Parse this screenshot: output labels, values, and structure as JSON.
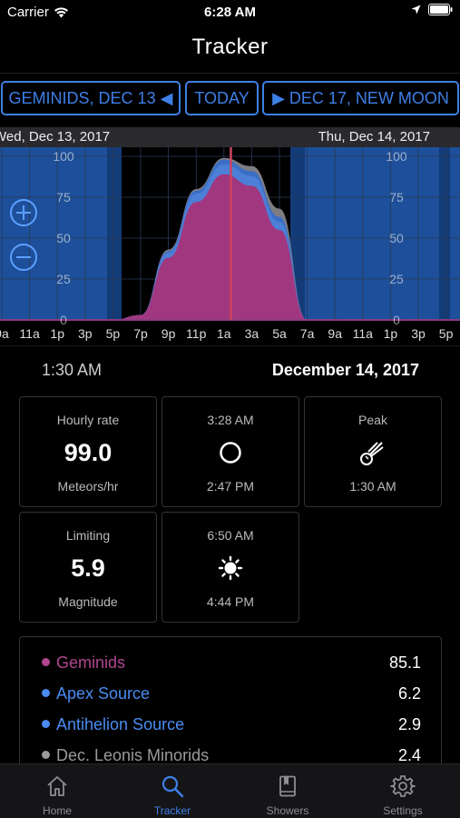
{
  "status_bar": {
    "carrier": "Carrier",
    "time": "6:28 AM"
  },
  "nav": {
    "title": "Tracker"
  },
  "date_nav": {
    "prev_label": "GEMINIDS, DEC 13 ◀",
    "today_label": "TODAY",
    "next_label": "▶ DEC 17, NEW MOON"
  },
  "date_strip": {
    "left": "Wed, Dec 13, 2017",
    "right": "Thu, Dec 14, 2017"
  },
  "chart_data": {
    "type": "area",
    "x": [
      "9a",
      "11a",
      "1p",
      "3p",
      "5p",
      "7p",
      "9p",
      "11p",
      "1a",
      "3a",
      "5a",
      "7a",
      "9a",
      "11a",
      "1p",
      "3p",
      "5p"
    ],
    "ytick_labels": [
      "100",
      "75",
      "50",
      "25",
      "0"
    ],
    "ylim": [
      0,
      100
    ],
    "selected_x": "1:30 AM",
    "series": [
      {
        "name": "Geminids",
        "color": "#a0377f",
        "values": [
          0,
          0,
          0,
          0,
          0,
          3,
          38,
          72,
          89,
          82,
          55,
          0,
          0,
          0,
          0,
          0,
          0
        ]
      },
      {
        "name": "Apex Source",
        "color": "#4a86e0",
        "values": [
          0,
          0,
          0,
          0,
          0,
          3,
          41,
          77,
          95,
          88,
          60,
          0,
          0,
          0,
          0,
          0,
          0
        ]
      },
      {
        "name": "Antihelion Source",
        "color": "#4a86e0",
        "values": [
          0,
          0,
          0,
          0,
          0,
          3,
          42,
          79,
          98,
          91,
          63,
          0,
          0,
          0,
          0,
          0,
          0
        ]
      },
      {
        "name": "Dec. Leonis Minorids",
        "color": "#8e8e8e",
        "values": [
          0,
          0,
          0,
          0,
          0,
          3,
          43,
          80,
          99,
          94,
          68,
          0,
          0,
          0,
          0,
          0,
          0
        ]
      }
    ],
    "grid": true
  },
  "selection": {
    "time": "1:30 AM",
    "date": "December 14, 2017"
  },
  "cards": {
    "hourly": {
      "top": "Hourly rate",
      "value": "99.0",
      "bottom": "Meteors/hr"
    },
    "moon": {
      "top": "3:28 AM",
      "bottom": "2:47 PM"
    },
    "peak": {
      "top": "Peak",
      "bottom": "1:30 AM"
    },
    "limiting": {
      "top": "Limiting",
      "value": "5.9",
      "bottom": "Magnitude"
    },
    "sun": {
      "top": "6:50 AM",
      "bottom": "4:44 PM"
    }
  },
  "showers": [
    {
      "name": "Geminids",
      "value": "85.1",
      "color": "#b0468f"
    },
    {
      "name": "Apex Source",
      "value": "6.2",
      "color": "#4a8cf0"
    },
    {
      "name": "Antihelion Source",
      "value": "2.9",
      "color": "#4a8cf0"
    },
    {
      "name": "Dec. Leonis Minorids",
      "value": "2.4",
      "color": "#9a9a9a"
    }
  ],
  "tabs": [
    {
      "label": "Home",
      "icon": "home-icon"
    },
    {
      "label": "Tracker",
      "icon": "search-icon"
    },
    {
      "label": "Showers",
      "icon": "book-icon"
    },
    {
      "label": "Settings",
      "icon": "gear-icon"
    }
  ],
  "colors": {
    "accent": "#3e7fe6",
    "background": "#000000",
    "night_band": "#1d4f9a"
  }
}
